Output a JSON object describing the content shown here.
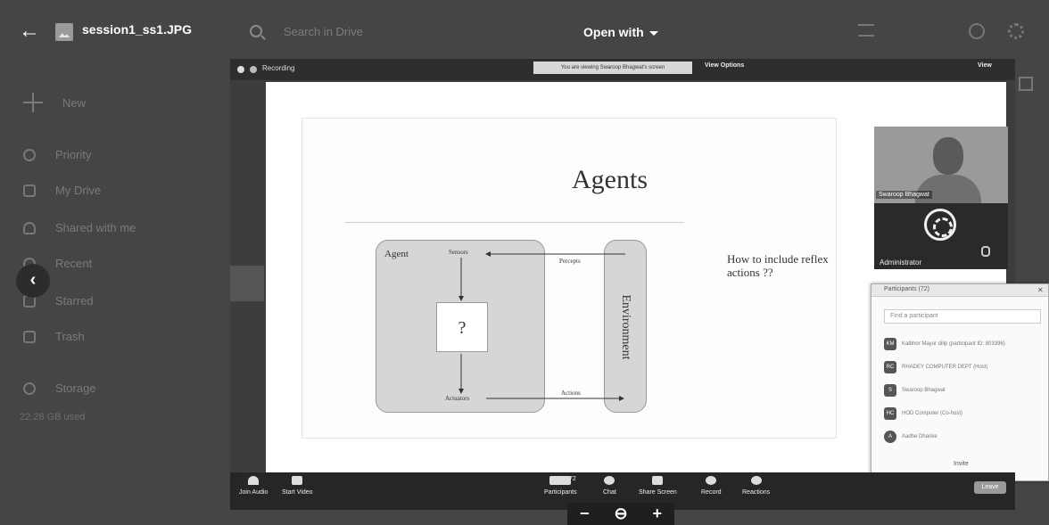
{
  "viewer": {
    "file_name": "session1_ss1.JPG",
    "open_with_label": "Open with",
    "search_placeholder": "Search in Drive"
  },
  "sidebar": {
    "items": [
      {
        "label": "New"
      },
      {
        "label": "Priority"
      },
      {
        "label": "My Drive"
      },
      {
        "label": "Shared with me"
      },
      {
        "label": "Recent"
      },
      {
        "label": "Starred"
      },
      {
        "label": "Trash"
      },
      {
        "label": "Storage"
      }
    ],
    "storage_used": "22.28 GB used"
  },
  "meeting": {
    "recording_label": "Recording",
    "viewing_banner": "You are viewing Swaroop Bhagwat's screen",
    "view_options_label": "View Options",
    "view_label": "View",
    "slide": {
      "title": "Agents",
      "agent_label": "Agent",
      "sensors_label": "Sensors",
      "actuators_label": "Actuators",
      "percepts_label": "Percepts",
      "actions_label": "Actions",
      "environment_label": "Environment",
      "question_mark": "?",
      "question_text": "How to include reflex actions ??"
    },
    "video_name": "Swaroop Bhagwat",
    "admin_name": "Administrator",
    "participants_panel": {
      "title": "Participants (72)",
      "search_placeholder": "Find a participant",
      "rows": [
        {
          "initials": "KM",
          "name": "Kalbhor Mayur dilip (participant ID: 803396)"
        },
        {
          "initials": "RC",
          "name": "RHADEY COMPUTER DEPT (Host)"
        },
        {
          "initials": "S",
          "name": "Swaroop Bhagwat"
        },
        {
          "initials": "HC",
          "name": "HOD Computer (Co-host)"
        },
        {
          "initials": "A",
          "name": "Aadhe Dhanke"
        }
      ],
      "invite_label": "Invite"
    },
    "toolbar": {
      "join_audio": "Join Audio",
      "start_video": "Start Video",
      "participants": "Participants",
      "participants_count": "72",
      "chat": "Chat",
      "share_screen": "Share Screen",
      "record": "Record",
      "reactions": "Reactions",
      "leave": "Leave"
    }
  },
  "zoom_controls": {
    "minus": "−",
    "zoom_icon": "⊖",
    "plus": "+"
  }
}
